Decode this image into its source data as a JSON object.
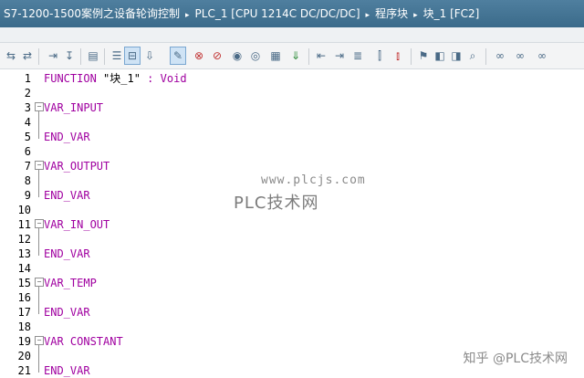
{
  "breadcrumb": {
    "items": [
      "S7-1200-1500案例之设备轮询控制",
      "PLC_1 [CPU 1214C DC/DC/DC]",
      "程序块",
      "块_1 [FC2]"
    ],
    "separator": "▸"
  },
  "toolbar": {
    "icons": [
      "insert-network-icon",
      "delete-network-icon",
      "insert-row-icon",
      "add-row-icon",
      "lock-icon",
      "comment-block-icon",
      "absolute-operand-icon",
      "expand-icon",
      "favorites-icon",
      "breakpoint-icon",
      "breakpoint-clear-icon",
      "watch-icon",
      "watch-off-icon",
      "monitor-icon",
      "download-icon",
      "indent-left-icon",
      "indent-right-icon",
      "align-icon",
      "comment-icon",
      "uncomment-icon",
      "bookmark-icon",
      "bookmark-prev-icon",
      "bookmark-next-icon",
      "find-icon",
      "glasses-icon",
      "glasses-2-icon",
      "glasses-3-icon"
    ]
  },
  "code": {
    "lines": [
      {
        "n": "1",
        "text": "FUNCTION \"块_1\" : Void",
        "fold": false
      },
      {
        "n": "2",
        "text": "",
        "fold": false
      },
      {
        "n": "3",
        "text": "VAR_INPUT",
        "fold": true
      },
      {
        "n": "4",
        "text": "",
        "fold": false
      },
      {
        "n": "5",
        "text": "END_VAR",
        "fold": false
      },
      {
        "n": "6",
        "text": "",
        "fold": false
      },
      {
        "n": "7",
        "text": "VAR_OUTPUT",
        "fold": true
      },
      {
        "n": "8",
        "text": "",
        "fold": false
      },
      {
        "n": "9",
        "text": "END_VAR",
        "fold": false
      },
      {
        "n": "10",
        "text": "",
        "fold": false
      },
      {
        "n": "11",
        "text": "VAR_IN_OUT",
        "fold": true
      },
      {
        "n": "12",
        "text": "",
        "fold": false
      },
      {
        "n": "13",
        "text": "END_VAR",
        "fold": false
      },
      {
        "n": "14",
        "text": "",
        "fold": false
      },
      {
        "n": "15",
        "text": "VAR_TEMP",
        "fold": true
      },
      {
        "n": "16",
        "text": "",
        "fold": false
      },
      {
        "n": "17",
        "text": "END_VAR",
        "fold": false
      },
      {
        "n": "18",
        "text": "",
        "fold": false
      },
      {
        "n": "19",
        "text": "VAR CONSTANT",
        "fold": true
      },
      {
        "n": "20",
        "text": "",
        "fold": false
      },
      {
        "n": "21",
        "text": "END_VAR",
        "fold": false
      }
    ],
    "line1": {
      "keyword": "FUNCTION",
      "name": "\"块_1\"",
      "colon": ":",
      "type": "Void"
    }
  },
  "watermarks": {
    "site": "www.plcjs.com",
    "brand": "PLC技术网",
    "corner": "知乎 @PLC技术网"
  },
  "colors": {
    "keyword": "#a000a0",
    "titlebar": "#3b6b8a"
  }
}
